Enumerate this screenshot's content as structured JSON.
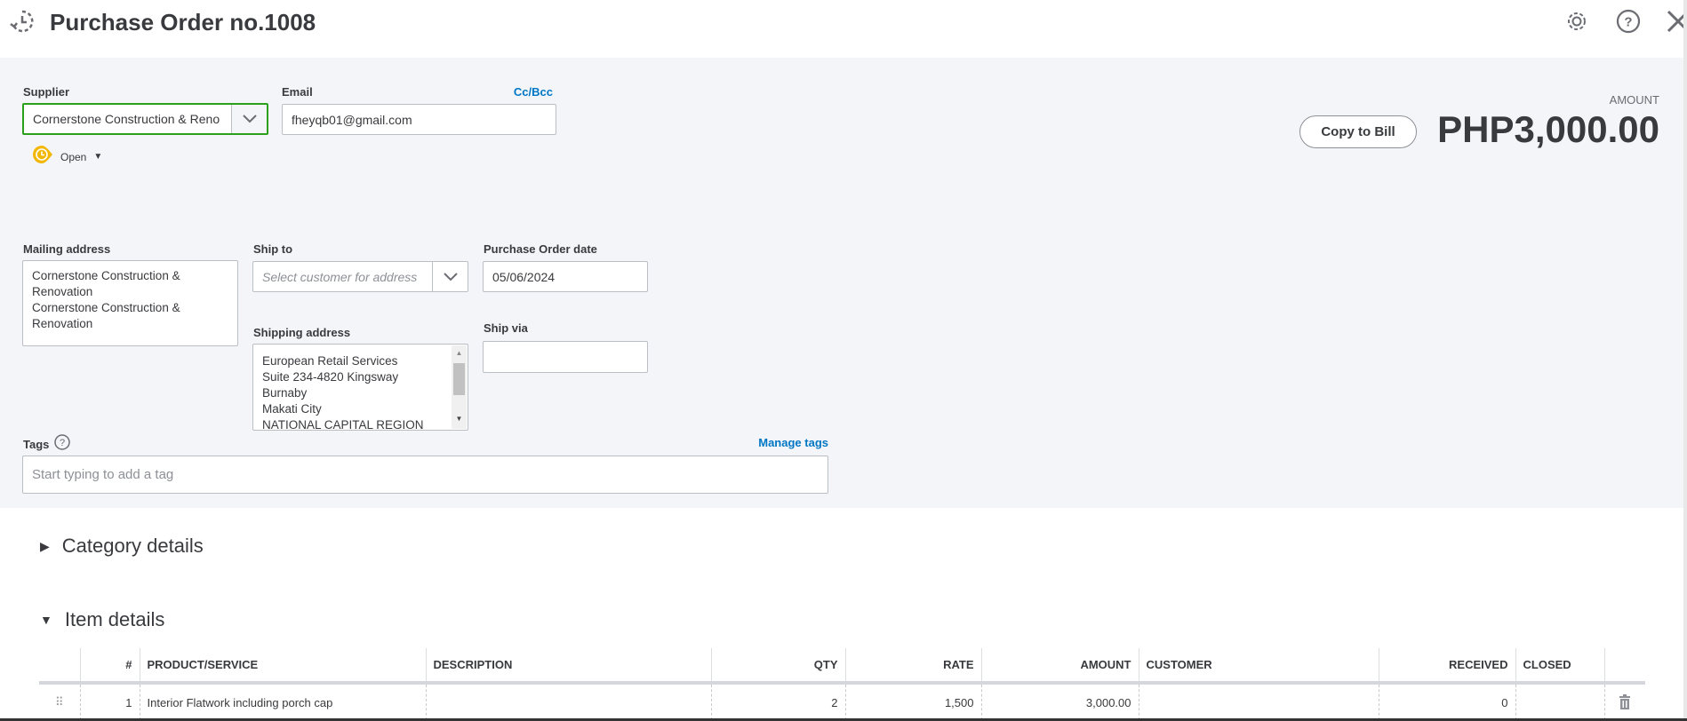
{
  "header": {
    "title": "Purchase Order no.1008",
    "icons": [
      "recent-transactions-icon",
      "gear-icon",
      "help-icon",
      "close-icon"
    ]
  },
  "form": {
    "supplier_label": "Supplier",
    "supplier_value": "Cornerstone Construction & Reno",
    "email_label": "Email",
    "email_value": "fheyqb01@gmail.com",
    "ccbcc": "Cc/Bcc",
    "status": "Open",
    "amount_label": "AMOUNT",
    "amount": "PHP3,000.00",
    "copy_to_bill": "Copy to Bill",
    "mailing_label": "Mailing address",
    "mailing_lines": [
      "Cornerstone Construction &",
      "Renovation",
      "Cornerstone Construction &",
      "Renovation"
    ],
    "shipto_label": "Ship to",
    "shipto_placeholder": "Select customer for address",
    "po_date_label": "Purchase Order date",
    "po_date": "05/06/2024",
    "shipping_label": "Shipping address",
    "shipping_lines": [
      "European Retail Services",
      "Suite 234-4820 Kingsway",
      "Burnaby",
      "Makati City",
      "NATIONAL CAPITAL REGION"
    ],
    "shipvia_label": "Ship via",
    "shipvia_value": "",
    "tags_label": "Tags",
    "manage_tags": "Manage tags",
    "tags_placeholder": "Start typing to add a tag"
  },
  "sections": {
    "category": "Category details",
    "item": "Item details"
  },
  "table": {
    "headers": [
      "#",
      "PRODUCT/SERVICE",
      "DESCRIPTION",
      "QTY",
      "RATE",
      "AMOUNT",
      "CUSTOMER",
      "RECEIVED",
      "CLOSED"
    ],
    "rows": [
      {
        "num": "1",
        "product": "Interior Flatwork including porch cap",
        "description": "",
        "qty": "2",
        "rate": "1,500",
        "amount": "3,000.00",
        "customer": "",
        "received": "0",
        "closed": ""
      }
    ]
  },
  "colors": {
    "accent": "#0077c5",
    "focus": "#2ca01c",
    "status": "#f2b705",
    "bg": "#f4f5f8"
  }
}
